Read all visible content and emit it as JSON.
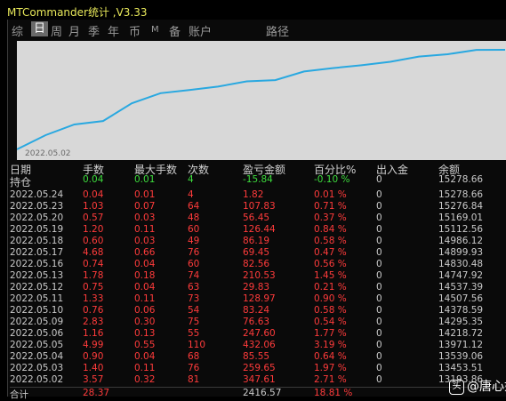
{
  "window": {
    "title": "MTCommander统计 ,V3.33"
  },
  "tabs": [
    "综",
    "日",
    "周",
    "月",
    "季",
    "年",
    "币",
    "M",
    "备",
    "账户",
    "路径"
  ],
  "active_tab": "日",
  "chart": {
    "start_label": "2022.05.02",
    "line_color": "#29a8e0",
    "bg_color": "#d8d8d8"
  },
  "table": {
    "headers": [
      "日期",
      "手数",
      "最大手数",
      "次数",
      "盈亏金额",
      "百分比%",
      "出入金",
      "余额"
    ],
    "holding": [
      "持仓",
      "0.04",
      "0.01",
      "4",
      "-15.84",
      "-0.10 %",
      "0",
      "15278.66"
    ],
    "rows": [
      [
        "2022.05.24",
        "0.04",
        "0.01",
        "4",
        "1.82",
        "0.01 %",
        "0",
        "15278.66"
      ],
      [
        "2022.05.23",
        "1.03",
        "0.07",
        "64",
        "107.83",
        "0.71 %",
        "0",
        "15276.84"
      ],
      [
        "2022.05.20",
        "0.57",
        "0.03",
        "48",
        "56.45",
        "0.37 %",
        "0",
        "15169.01"
      ],
      [
        "2022.05.19",
        "1.20",
        "0.11",
        "60",
        "126.44",
        "0.84 %",
        "0",
        "15112.56"
      ],
      [
        "2022.05.18",
        "0.60",
        "0.03",
        "49",
        "86.19",
        "0.58 %",
        "0",
        "14986.12"
      ],
      [
        "2022.05.17",
        "4.68",
        "0.66",
        "76",
        "69.45",
        "0.47 %",
        "0",
        "14899.93"
      ],
      [
        "2022.05.16",
        "0.74",
        "0.04",
        "60",
        "82.56",
        "0.56 %",
        "0",
        "14830.48"
      ],
      [
        "2022.05.13",
        "1.78",
        "0.18",
        "74",
        "210.53",
        "1.45 %",
        "0",
        "14747.92"
      ],
      [
        "2022.05.12",
        "0.75",
        "0.04",
        "63",
        "29.83",
        "0.21 %",
        "0",
        "14537.39"
      ],
      [
        "2022.05.11",
        "1.33",
        "0.11",
        "73",
        "128.97",
        "0.90 %",
        "0",
        "14507.56"
      ],
      [
        "2022.05.10",
        "0.76",
        "0.06",
        "54",
        "83.24",
        "0.58 %",
        "0",
        "14378.59"
      ],
      [
        "2022.05.09",
        "2.83",
        "0.30",
        "75",
        "76.63",
        "0.54 %",
        "0",
        "14295.35"
      ],
      [
        "2022.05.06",
        "1.16",
        "0.13",
        "55",
        "247.60",
        "1.77 %",
        "0",
        "14218.72"
      ],
      [
        "2022.05.05",
        "4.99",
        "0.55",
        "110",
        "432.06",
        "3.19 %",
        "0",
        "13971.12"
      ],
      [
        "2022.05.04",
        "0.90",
        "0.04",
        "68",
        "85.55",
        "0.64 %",
        "0",
        "13539.06"
      ],
      [
        "2022.05.03",
        "1.40",
        "0.11",
        "76",
        "259.65",
        "1.97 %",
        "0",
        "13453.51"
      ],
      [
        "2022.05.02",
        "3.57",
        "0.32",
        "81",
        "347.61",
        "2.71 %",
        "0",
        "13193.86"
      ]
    ],
    "total": [
      "合计",
      "28.37",
      "",
      "",
      "2416.57",
      "18.81 %",
      "",
      ""
    ]
  },
  "watermark": {
    "icon": "toutiao-logo-icon",
    "text": "@唐心如"
  }
}
